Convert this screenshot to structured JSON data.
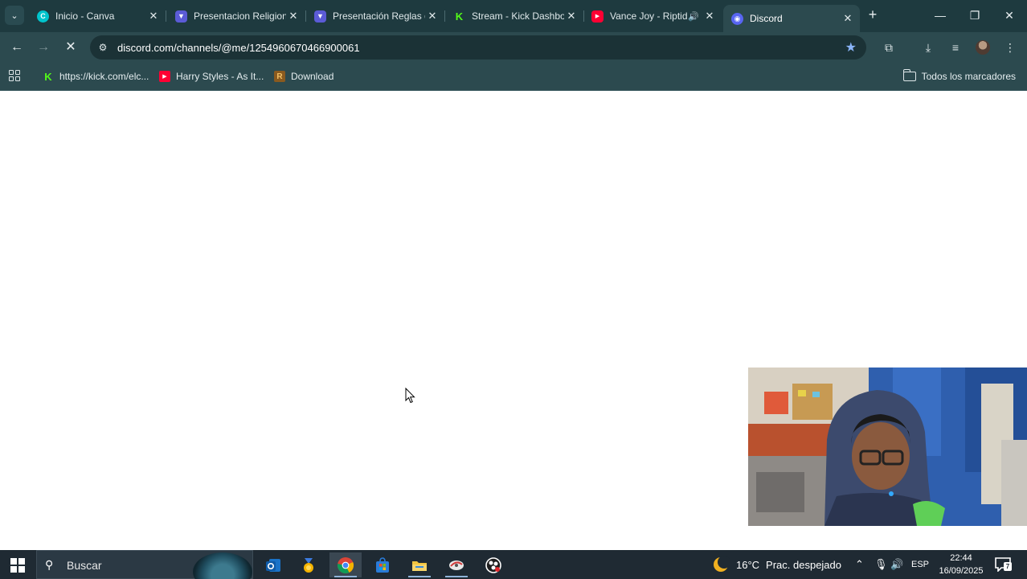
{
  "browser": {
    "tabs": [
      {
        "title": "Inicio - Canva",
        "active": false
      },
      {
        "title": "Presentacion Religion",
        "active": false
      },
      {
        "title": "Presentación Reglas d",
        "active": false
      },
      {
        "title": "Stream - Kick Dashbo",
        "active": false
      },
      {
        "title": "Vance Joy - Riptid",
        "active": false
      },
      {
        "title": "Discord",
        "active": true
      }
    ],
    "url": "discord.com/channels/@me/1254960670466900061",
    "bookmarks": [
      {
        "label": "https://kick.com/elc..."
      },
      {
        "label": "Harry Styles - As It..."
      },
      {
        "label": "Download"
      }
    ],
    "all_bookmarks_label": "Todos los marcadores"
  },
  "taskbar": {
    "search_placeholder": "Buscar",
    "weather": "16°C",
    "weather_desc": "Prac. despejado",
    "language": "ESP",
    "time": "22:44",
    "date": "16/09/2025",
    "notification_count": "7"
  },
  "colors": {
    "tabstrip": "#1e3a3f",
    "toolbar": "#2c4a4f",
    "taskbar": "#1f2a33",
    "kick_green": "#53fc18",
    "youtube_red": "#ff0033"
  }
}
